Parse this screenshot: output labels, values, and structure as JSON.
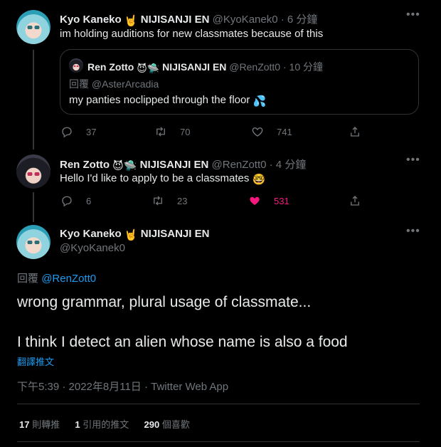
{
  "tweet1": {
    "name": "Kyo Kaneko",
    "name_suffix": "NIJISANJI EN",
    "handle": "@KyoKanek0",
    "time": "· 6 分鐘",
    "text": "im holding auditions for new classmates because of this",
    "quote": {
      "name": "Ren Zotto",
      "name_suffix": "NIJISANJI EN",
      "handle": "@RenZott0",
      "time": "· 10 分鐘",
      "reply_prefix": "回覆",
      "reply_to": "@AsterArcadia",
      "text": "my panties noclipped through the floor"
    },
    "replies": "37",
    "retweets": "70",
    "likes": "741"
  },
  "tweet2": {
    "name": "Ren Zotto",
    "name_suffix": "NIJISANJI EN",
    "handle": "@RenZott0",
    "time": "· 4 分鐘",
    "text": "Hello I'd like to apply to be a classmates",
    "replies": "6",
    "retweets": "23",
    "likes": "531"
  },
  "main": {
    "name": "Kyo Kaneko",
    "name_suffix": "NIJISANJI EN",
    "handle": "@KyoKanek0",
    "reply_prefix": "回覆",
    "reply_to": "@RenZott0",
    "text_line1": "wrong grammar, plural usage of classmate...",
    "text_line2": "I think I detect an alien whose name is also a food",
    "translate": "翻譯推文",
    "timestamp": "下午5:39 · 2022年8月11日 · Twitter Web App",
    "stats": {
      "retweets_count": "17",
      "retweets_label": "則轉推",
      "quotes_count": "1",
      "quotes_label": "引用的推文",
      "likes_count": "290",
      "likes_label": "個喜歡"
    }
  },
  "colors": {
    "background": "#000000",
    "text": "#e7e9ea",
    "muted": "#71767b",
    "link": "#1d9bf0",
    "like_active": "#f91880"
  }
}
